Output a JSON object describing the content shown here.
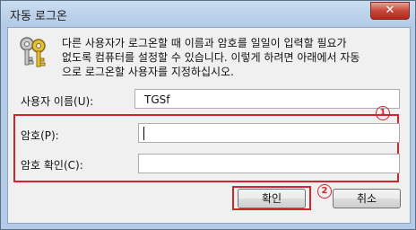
{
  "window": {
    "title": "자동 로그온",
    "close_symbol": "✕"
  },
  "description": {
    "line1": "다른 사용자가 로그온할 때 이름과 암호를 일일이 입력할 필요가",
    "line2": "없도록 컴퓨터를 설정할 수 있습니다. 이렇게 하려면 아래에서 자동",
    "line3": "으로 로그온할 사용자를 지정하십시오."
  },
  "form": {
    "username_label": "사용자 이름(U):",
    "username_value": "TGSf",
    "password_label": "암호(P):",
    "password_value": "",
    "confirm_label": "암호 확인(C):",
    "confirm_value": ""
  },
  "annotations": {
    "badge1": "1",
    "badge2": "2",
    "color": "#d4242c"
  },
  "buttons": {
    "ok": "확인",
    "cancel": "취소"
  },
  "icons": {
    "dialog": "keys-icon"
  }
}
